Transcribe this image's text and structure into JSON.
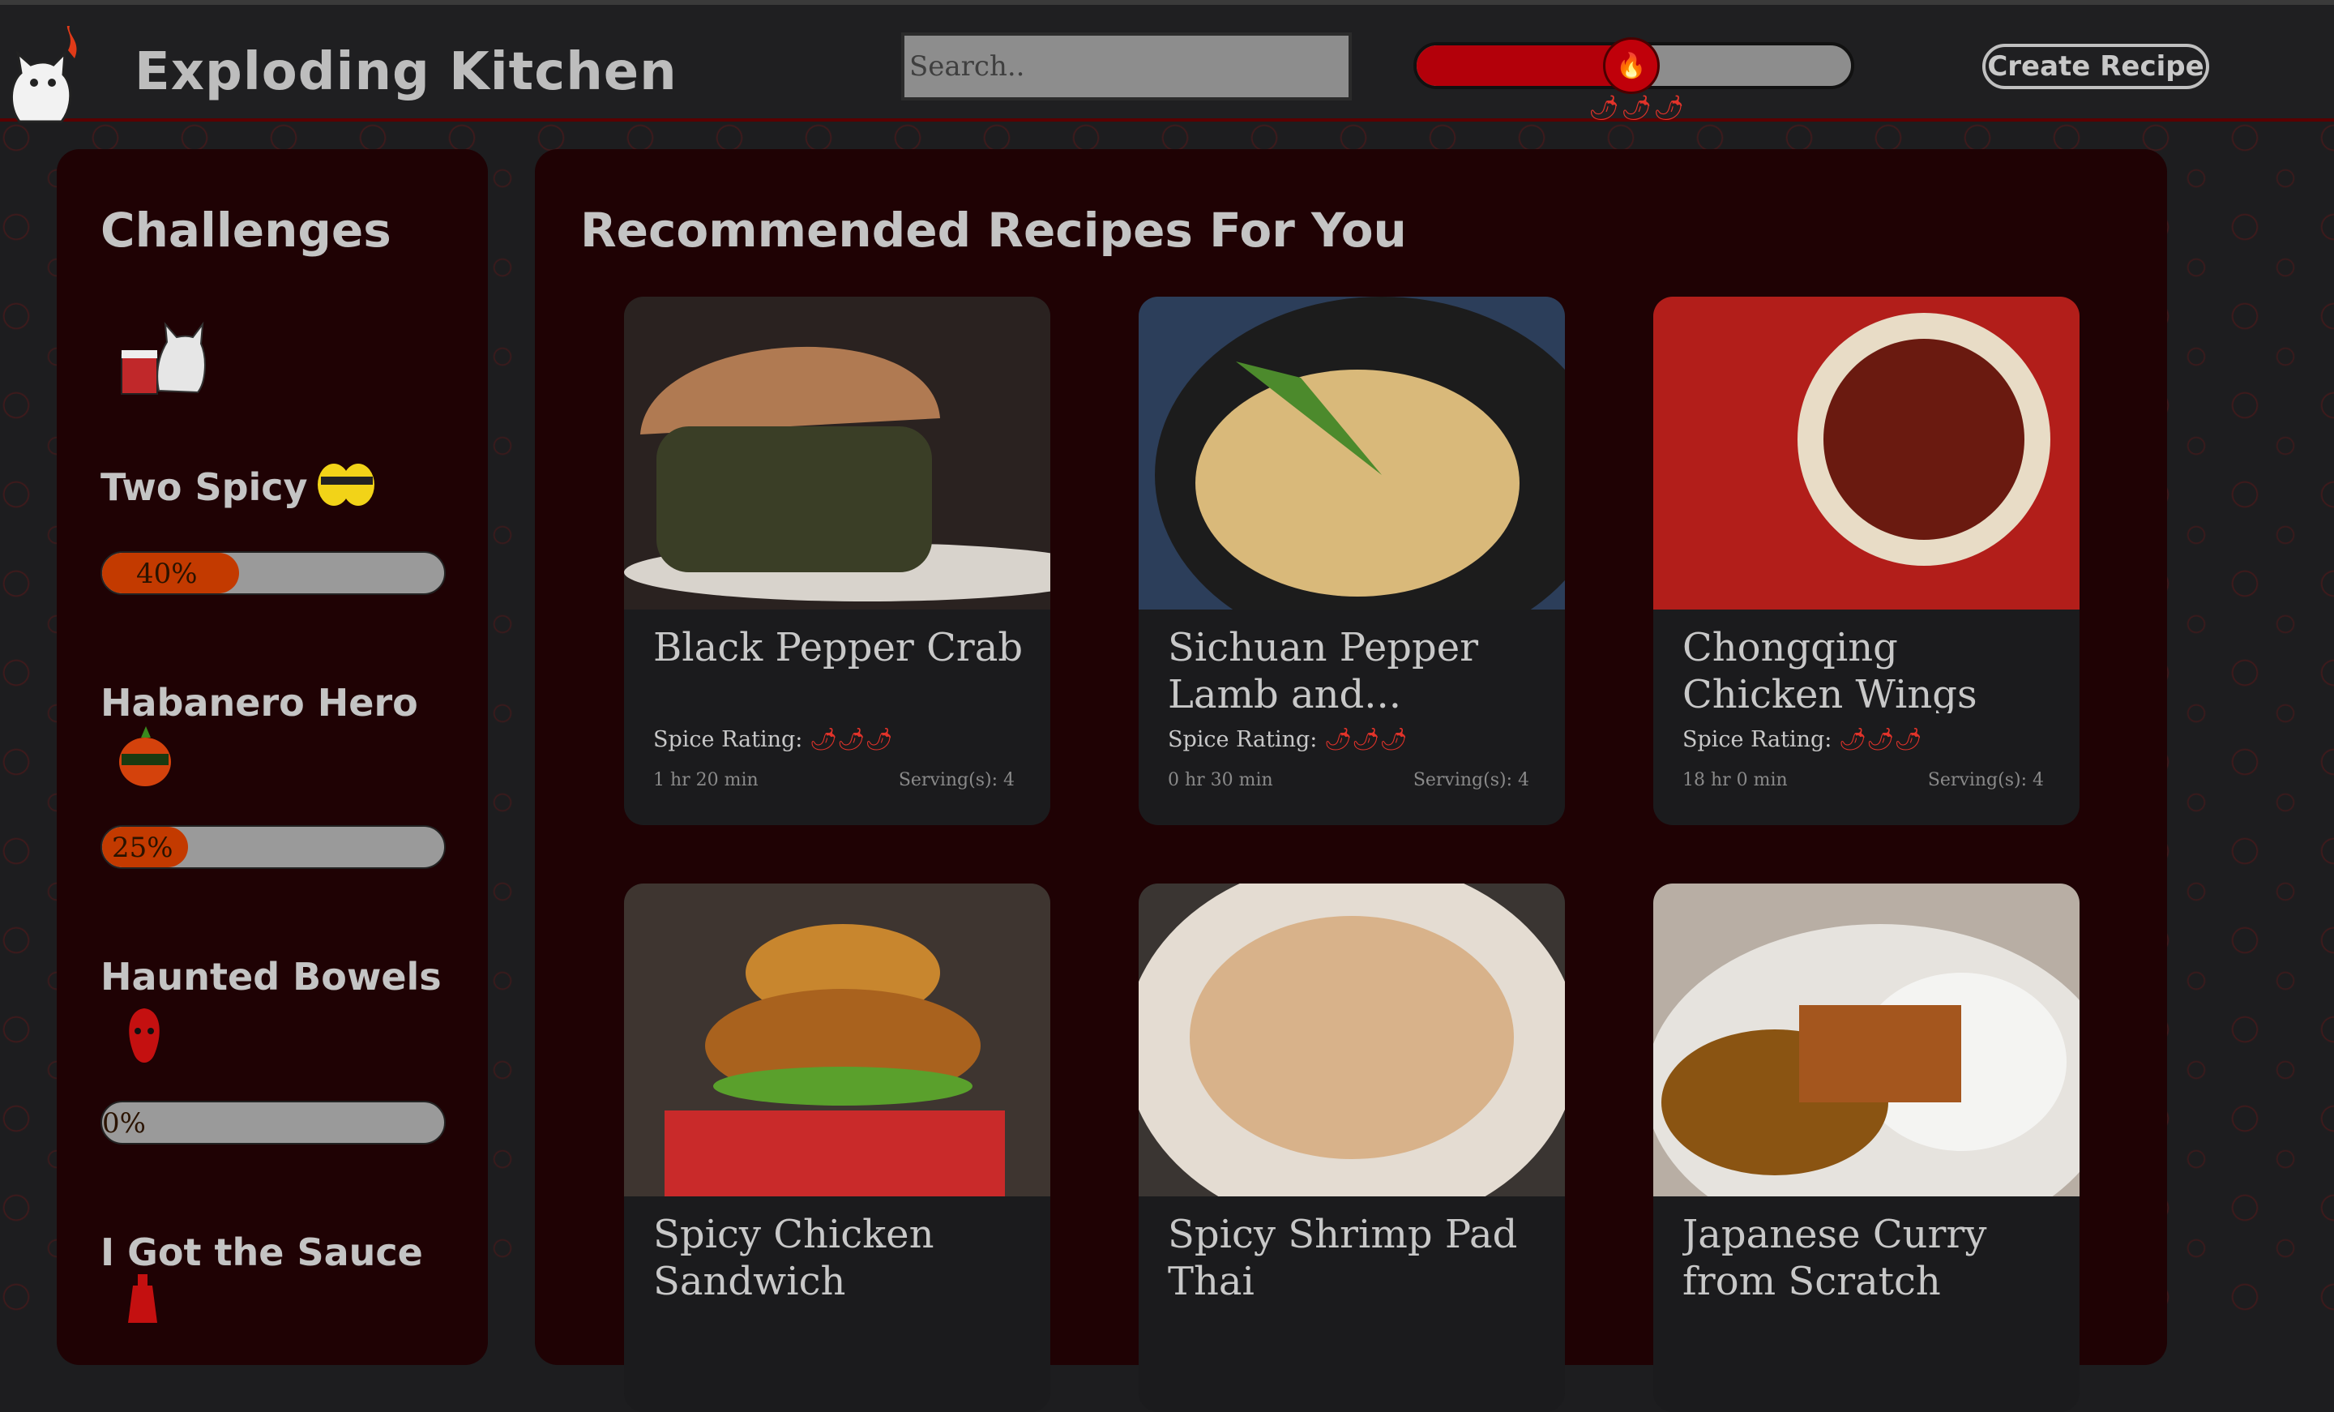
{
  "header": {
    "logo_title": "Exploding Kitchen",
    "search_placeholder": "Search..",
    "spice_level_fraction": 0.5,
    "slider_peppers": "🌶🌶🌶",
    "slider_thumb_icon": "🔥",
    "create_button": "Create Recipe"
  },
  "sidebar": {
    "title": "Challenges",
    "challenges": [
      {
        "name": "Two Spicy",
        "progress": 40,
        "label": "40%",
        "icon": "yellow-peppers-sunglasses-icon"
      },
      {
        "name": "Habanero Hero",
        "progress": 25,
        "label": "25%",
        "icon": "masked-habanero-icon"
      },
      {
        "name": "Haunted Bowels",
        "progress": 0,
        "label": "0%",
        "icon": "devil-pepper-icon"
      },
      {
        "name": "I Got the Sauce",
        "progress": 0,
        "label": "",
        "icon": "hot-sauce-bottle-icon"
      }
    ]
  },
  "main": {
    "title": "Recommended Recipes For You",
    "spice_label": "Spice Rating:",
    "recipes": [
      {
        "title": "Black Pepper Crab",
        "time": "1 hr 20 min",
        "servings": "Serving(s): 4",
        "peppers": "🌶🌶🌶"
      },
      {
        "title": "Sichuan Pepper Lamb and...",
        "time": "0 hr 30 min",
        "servings": "Serving(s): 4",
        "peppers": "🌶🌶🌶"
      },
      {
        "title": "Chongqing Chicken Wings",
        "time": "18 hr 0 min",
        "servings": "Serving(s): 4",
        "peppers": "🌶🌶🌶"
      },
      {
        "title": "Spicy Chicken Sandwich",
        "time": "",
        "servings": "",
        "peppers": "🌶🌶🌶"
      },
      {
        "title": "Spicy Shrimp Pad Thai",
        "time": "",
        "servings": "",
        "peppers": "🌶🌶🌶"
      },
      {
        "title": "Japanese Curry from Scratch",
        "time": "",
        "servings": "",
        "peppers": "🌶🌶🌶"
      }
    ]
  },
  "colors": {
    "accent_red": "#b3000a",
    "progress_orange": "#c33a00",
    "panel_bg": "#1f0204",
    "page_bg": "#1d1d1f"
  }
}
